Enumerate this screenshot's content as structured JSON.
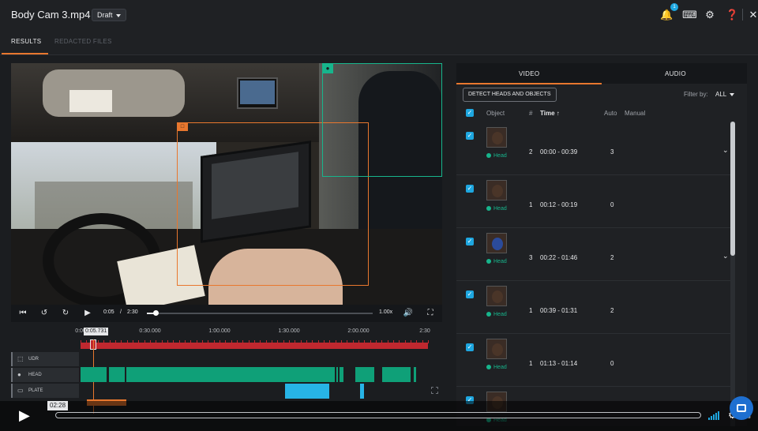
{
  "header": {
    "title": "Body Cam 3.mp4",
    "status_pill": "Draft",
    "notification_count": "1"
  },
  "tabs": [
    {
      "label": "RESULTS",
      "active": true
    },
    {
      "label": "REDACTED FILES",
      "active": false
    }
  ],
  "player": {
    "current_time": "0:05",
    "separator": "/",
    "duration": "2:30",
    "playback_rate": "1.00x",
    "progress_fraction": 0.04
  },
  "timeline": {
    "playhead_label": "0:05.731",
    "ruler_labels": [
      "0:00",
      "0:30.000",
      "1:00.000",
      "1:30.000",
      "2:00.000",
      "2:30"
    ],
    "tracks": [
      {
        "label": "UDR",
        "icon": "crop-icon"
      },
      {
        "label": "HEAD",
        "icon": "head-icon"
      },
      {
        "label": "PLATE",
        "icon": "plate-icon"
      }
    ]
  },
  "right_panel": {
    "tabs": [
      "VIDEO",
      "AUDIO"
    ],
    "detect_button": "DETECT HEADS AND OBJECTS",
    "filter_label": "Filter by:",
    "filter_value": "ALL",
    "columns": {
      "object": "Object",
      "num": "#",
      "time": "Time",
      "auto": "Auto",
      "manual": "Manual"
    },
    "rows": [
      {
        "tag": "Head",
        "num": "2",
        "time": "00:00 - 00:39",
        "auto": "3",
        "expandable": true
      },
      {
        "tag": "Head",
        "num": "1",
        "time": "00:12 - 00:19",
        "auto": "0",
        "expandable": false
      },
      {
        "tag": "Head",
        "num": "3",
        "time": "00:22 - 01:46",
        "auto": "2",
        "expandable": true
      },
      {
        "tag": "Head",
        "num": "1",
        "time": "00:39 - 01:31",
        "auto": "2",
        "expandable": false
      },
      {
        "tag": "Head",
        "num": "1",
        "time": "01:13 - 01:14",
        "auto": "0",
        "expandable": false
      },
      {
        "tag": "Head",
        "num": "",
        "time": "",
        "auto": "",
        "expandable": false
      }
    ]
  },
  "embed_player": {
    "time": "02:28"
  },
  "colors": {
    "accent_orange": "#e8772e",
    "head_green": "#0fa078",
    "plate_blue": "#27b4e6",
    "timeline_red": "#c0282f",
    "checkbox_blue": "#1ea7e0"
  }
}
